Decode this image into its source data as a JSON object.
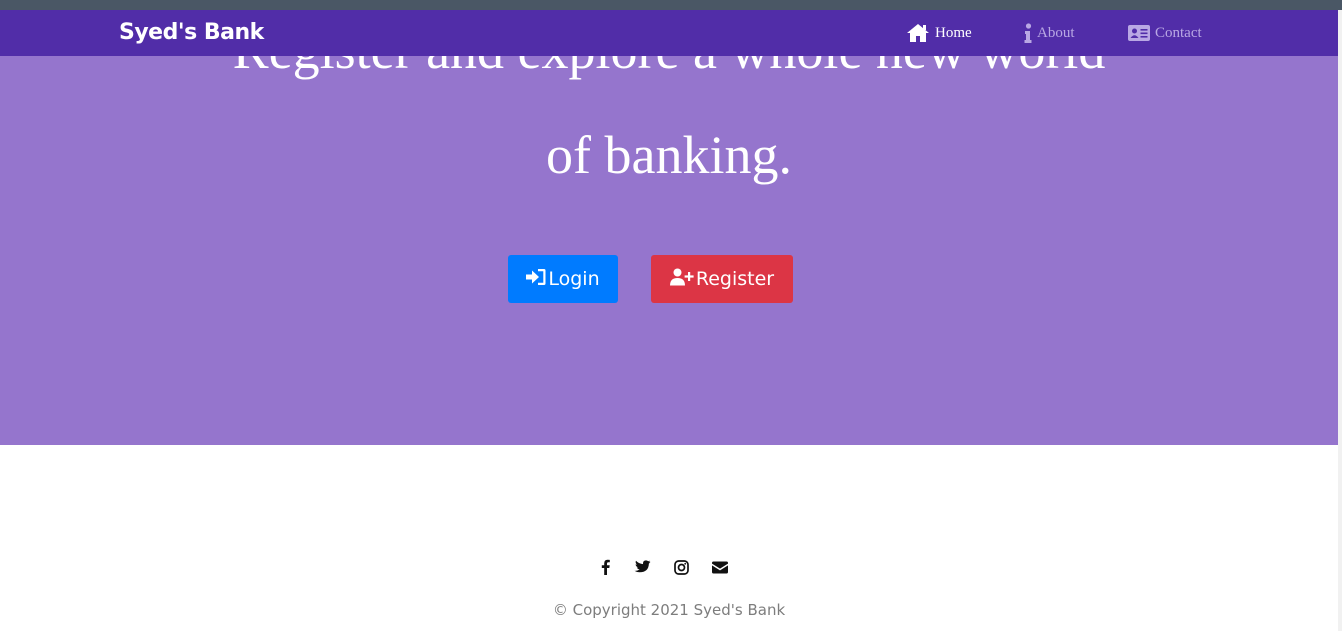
{
  "navbar": {
    "brand": "Syed's Bank",
    "links": [
      {
        "label": "Home",
        "icon": "home-icon",
        "active": true
      },
      {
        "label": "About",
        "icon": "info-icon",
        "active": false
      },
      {
        "label": "Contact",
        "icon": "address-card-icon",
        "active": false
      }
    ]
  },
  "hero": {
    "line1": "Register and explore a whole new world",
    "line2": "of banking."
  },
  "buttons": {
    "login": {
      "label": "Login",
      "icon": "sign-in-icon"
    },
    "register": {
      "label": "Register",
      "icon": "user-plus-icon"
    }
  },
  "footer": {
    "social_icons": [
      "facebook-icon",
      "twitter-icon",
      "instagram-icon",
      "envelope-icon"
    ],
    "copyright": "© Copyright 2021 Syed's Bank"
  },
  "colors": {
    "navbar": "#512da8",
    "hero": "#9575cd",
    "login": "#007bff",
    "register": "#dc3545"
  }
}
